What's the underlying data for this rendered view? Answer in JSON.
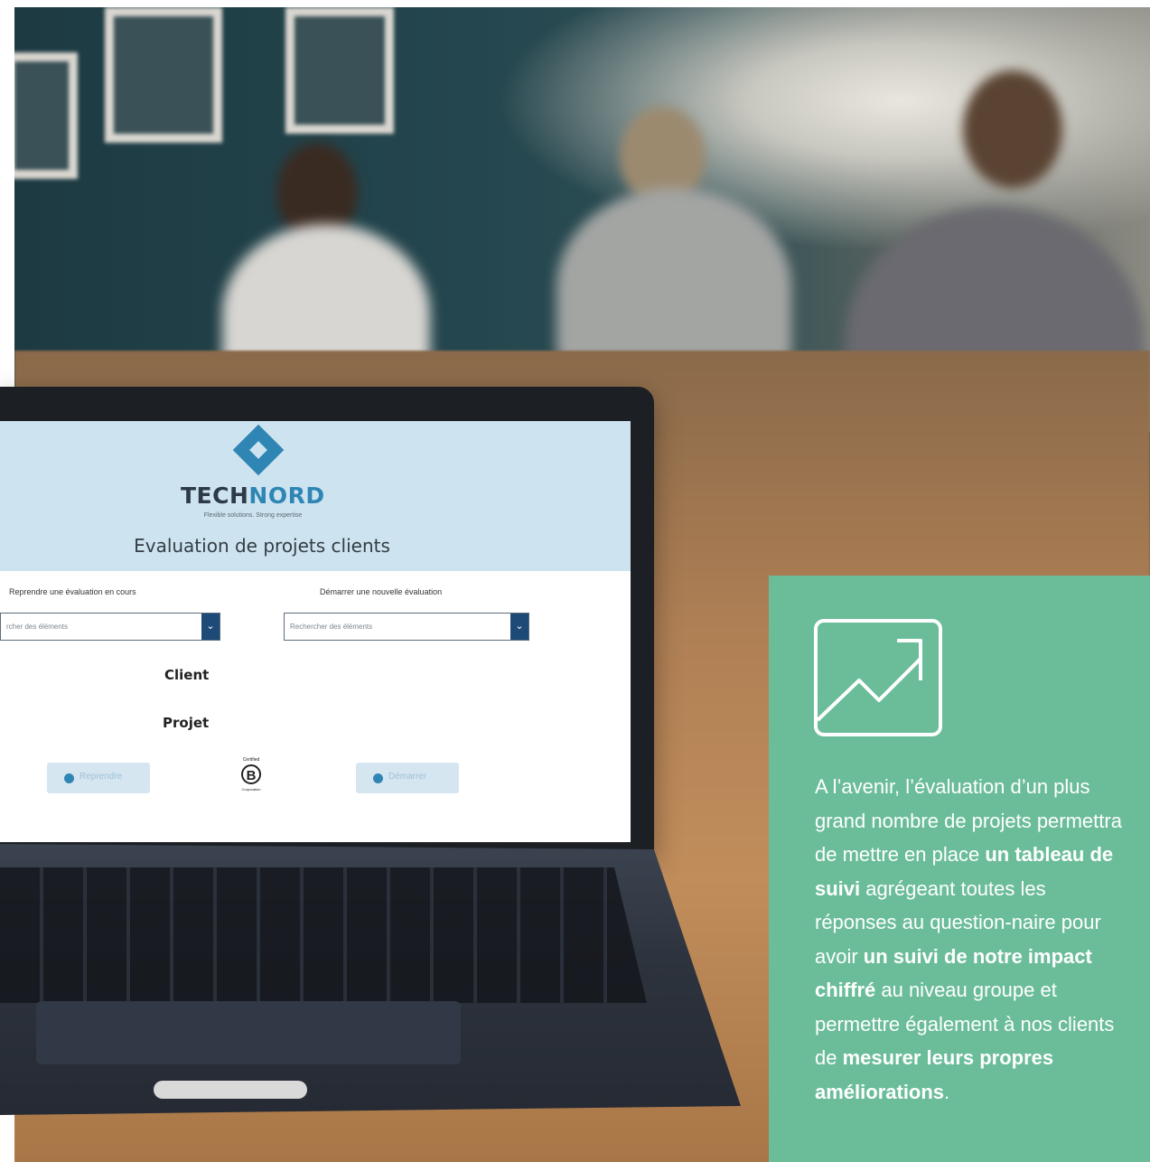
{
  "laptop_screen": {
    "brand_part1": "TECH",
    "brand_part2": "NORD",
    "tagline": "Flexible solutions. Strong expertise",
    "title": "Evaluation de projets clients",
    "resume_label": "Reprendre une évaluation en cours",
    "resume_placeholder": "rcher des éléments",
    "start_label": "Démarrer une nouvelle évaluation",
    "start_placeholder": "Rechercher des éléments",
    "dropdown_glyph": "⌄",
    "client_label": "Client",
    "projet_label": "Projet",
    "resume_button": "Reprendre",
    "start_button": "Démarrer",
    "bcorp_certified": "Certified",
    "bcorp_letter": "B",
    "bcorp_corporation": "Corporation"
  },
  "panel": {
    "icon": "trending-up-icon",
    "text_segments": [
      {
        "text": "A l’avenir, l’évaluation d’un plus grand nombre de projets permettra de mettre en place ",
        "bold": false
      },
      {
        "text": "un tableau de suivi",
        "bold": true
      },
      {
        "text": " agrégeant toutes les réponses au question-naire pour avoir ",
        "bold": false
      },
      {
        "text": "un suivi de notre impact chiffré",
        "bold": true
      },
      {
        "text": " au niveau groupe et permettre également à nos clients de ",
        "bold": false
      },
      {
        "text": "mesurer leurs propres améliorations",
        "bold": true
      },
      {
        "text": ".",
        "bold": false
      }
    ]
  },
  "colors": {
    "panel_bg": "#6bbd9a",
    "screen_header_bg": "#cde3ef",
    "brand_blue": "#2f86b4",
    "dropdown_blue": "#1e4a78"
  }
}
